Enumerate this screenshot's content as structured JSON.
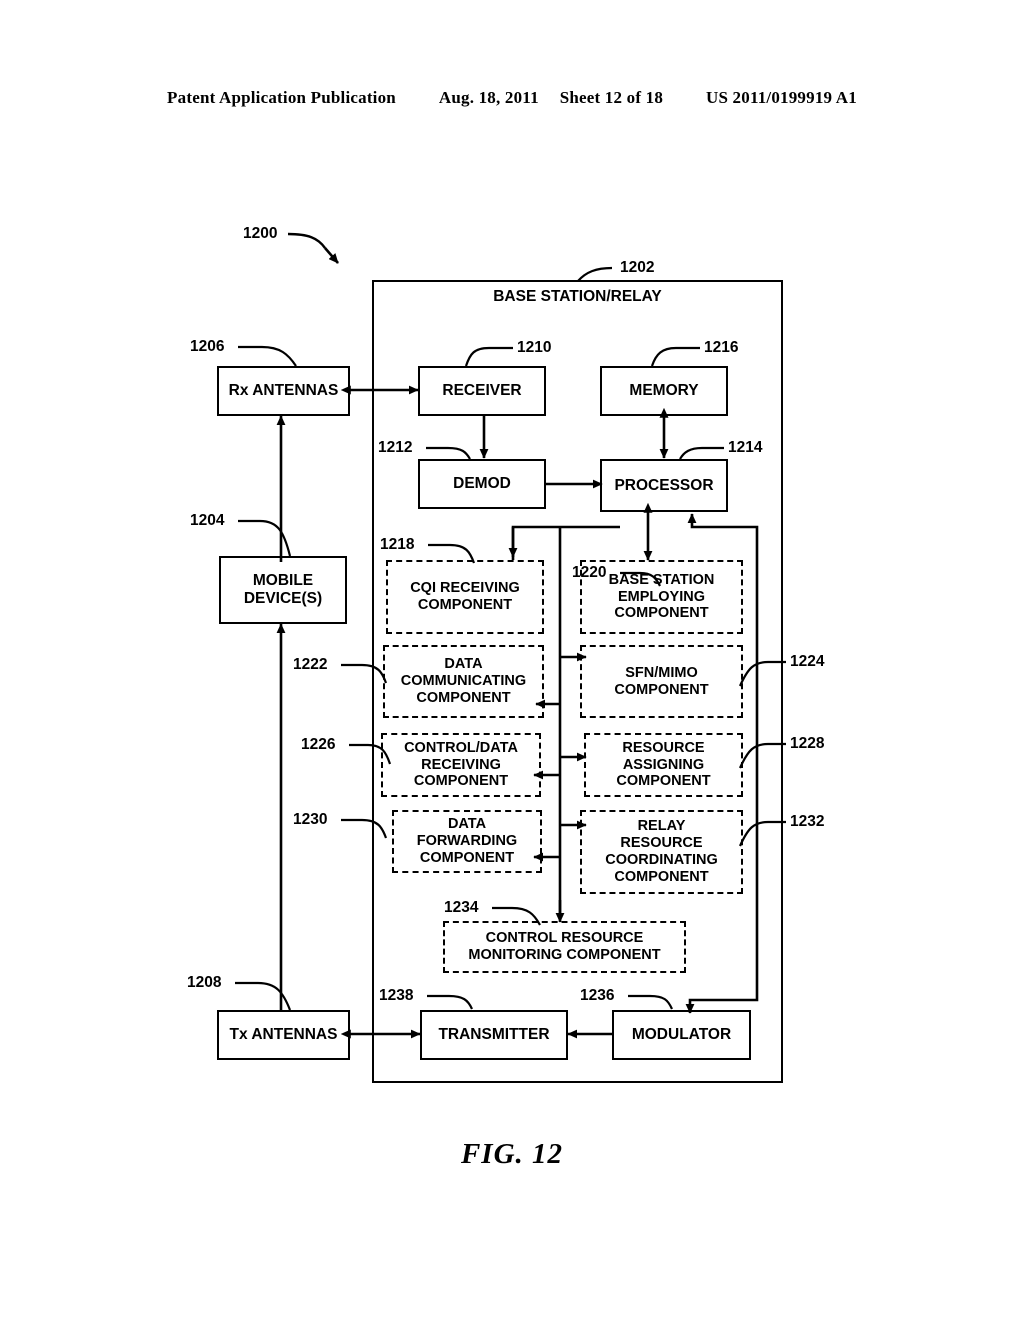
{
  "header": {
    "publication": "Patent Application Publication",
    "date": "Aug. 18, 2011",
    "sheet": "Sheet 12 of 18",
    "docnum": "US 2011/0199919 A1"
  },
  "figure": {
    "caption": "FIG. 12",
    "system_ref": "1200"
  },
  "container": {
    "title": "BASE STATION/RELAY",
    "ref": "1202"
  },
  "boxes": [
    {
      "id": "rx-antennas",
      "label": "Rx ANTENNAS",
      "ref": "1206",
      "style": "solid"
    },
    {
      "id": "mobile-devices",
      "label": "MOBILE\nDEVICE(S)",
      "ref": "1204",
      "style": "solid"
    },
    {
      "id": "tx-antennas",
      "label": "Tx ANTENNAS",
      "ref": "1208",
      "style": "solid"
    },
    {
      "id": "receiver",
      "label": "RECEIVER",
      "ref": "1210",
      "style": "solid"
    },
    {
      "id": "memory",
      "label": "MEMORY",
      "ref": "1216",
      "style": "solid"
    },
    {
      "id": "demod",
      "label": "DEMOD",
      "ref": "1212",
      "style": "solid"
    },
    {
      "id": "processor",
      "label": "PROCESSOR",
      "ref": "1214",
      "style": "solid"
    },
    {
      "id": "cqi-receiving",
      "label": "CQI RECEIVING\nCOMPONENT",
      "ref": "1218",
      "style": "dashed"
    },
    {
      "id": "base-station-employing",
      "label": "BASE STATION\nEMPLOYING\nCOMPONENT",
      "ref": "1220",
      "style": "dashed"
    },
    {
      "id": "data-communicating",
      "label": "DATA\nCOMMUNICATING\nCOMPONENT",
      "ref": "1222",
      "style": "dashed"
    },
    {
      "id": "sfn-mimo",
      "label": "SFN/MIMO\nCOMPONENT",
      "ref": "1224",
      "style": "dashed"
    },
    {
      "id": "control-data-receiving",
      "label": "CONTROL/DATA\nRECEIVING\nCOMPONENT",
      "ref": "1226",
      "style": "dashed"
    },
    {
      "id": "resource-assigning",
      "label": "RESOURCE\nASSIGNING\nCOMPONENT",
      "ref": "1228",
      "style": "dashed"
    },
    {
      "id": "data-forwarding",
      "label": "DATA\nFORWARDING\nCOMPONENT",
      "ref": "1230",
      "style": "dashed"
    },
    {
      "id": "relay-resource-coordinating",
      "label": "RELAY\nRESOURCE\nCOORDINATING\nCOMPONENT",
      "ref": "1232",
      "style": "dashed"
    },
    {
      "id": "control-resource-monitoring",
      "label": "CONTROL RESOURCE\nMONITORING COMPONENT",
      "ref": "1234",
      "style": "dashed"
    },
    {
      "id": "transmitter",
      "label": "TRANSMITTER",
      "ref": "1238",
      "style": "solid"
    },
    {
      "id": "modulator",
      "label": "MODULATOR",
      "ref": "1236",
      "style": "solid"
    }
  ],
  "colors": {
    "line": "#000000",
    "background": "#ffffff"
  }
}
